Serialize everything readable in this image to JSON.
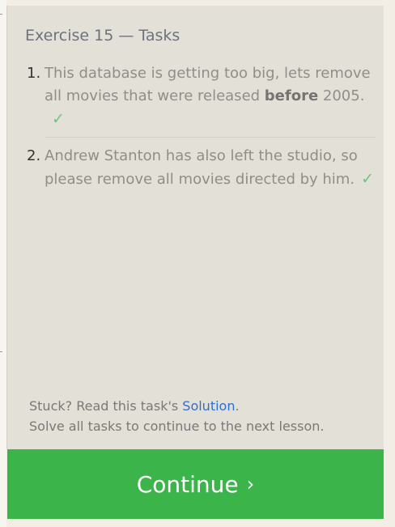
{
  "exercise": {
    "title": "Exercise 15 — Tasks"
  },
  "tasks": [
    {
      "number": "1.",
      "text_before": "This database is getting too big, lets remove all movies that were released ",
      "text_bold": "before",
      "text_after": " 2005.",
      "check": "✓"
    },
    {
      "number": "2.",
      "text": "Andrew Stanton has also left the studio, so please remove all movies directed by him.",
      "check": "✓"
    }
  ],
  "footer": {
    "stuck_prefix": "Stuck? Read this task's ",
    "solution_link": "Solution",
    "stuck_suffix": ".",
    "continue_note": "Solve all tasks to continue to the next lesson."
  },
  "continue_button": {
    "label": "Continue",
    "chevron": "›"
  },
  "colors": {
    "panel_bg": "#e3e0d7",
    "button_bg": "#3bb54a",
    "check": "#6fc482",
    "link": "#2f6fd0"
  }
}
